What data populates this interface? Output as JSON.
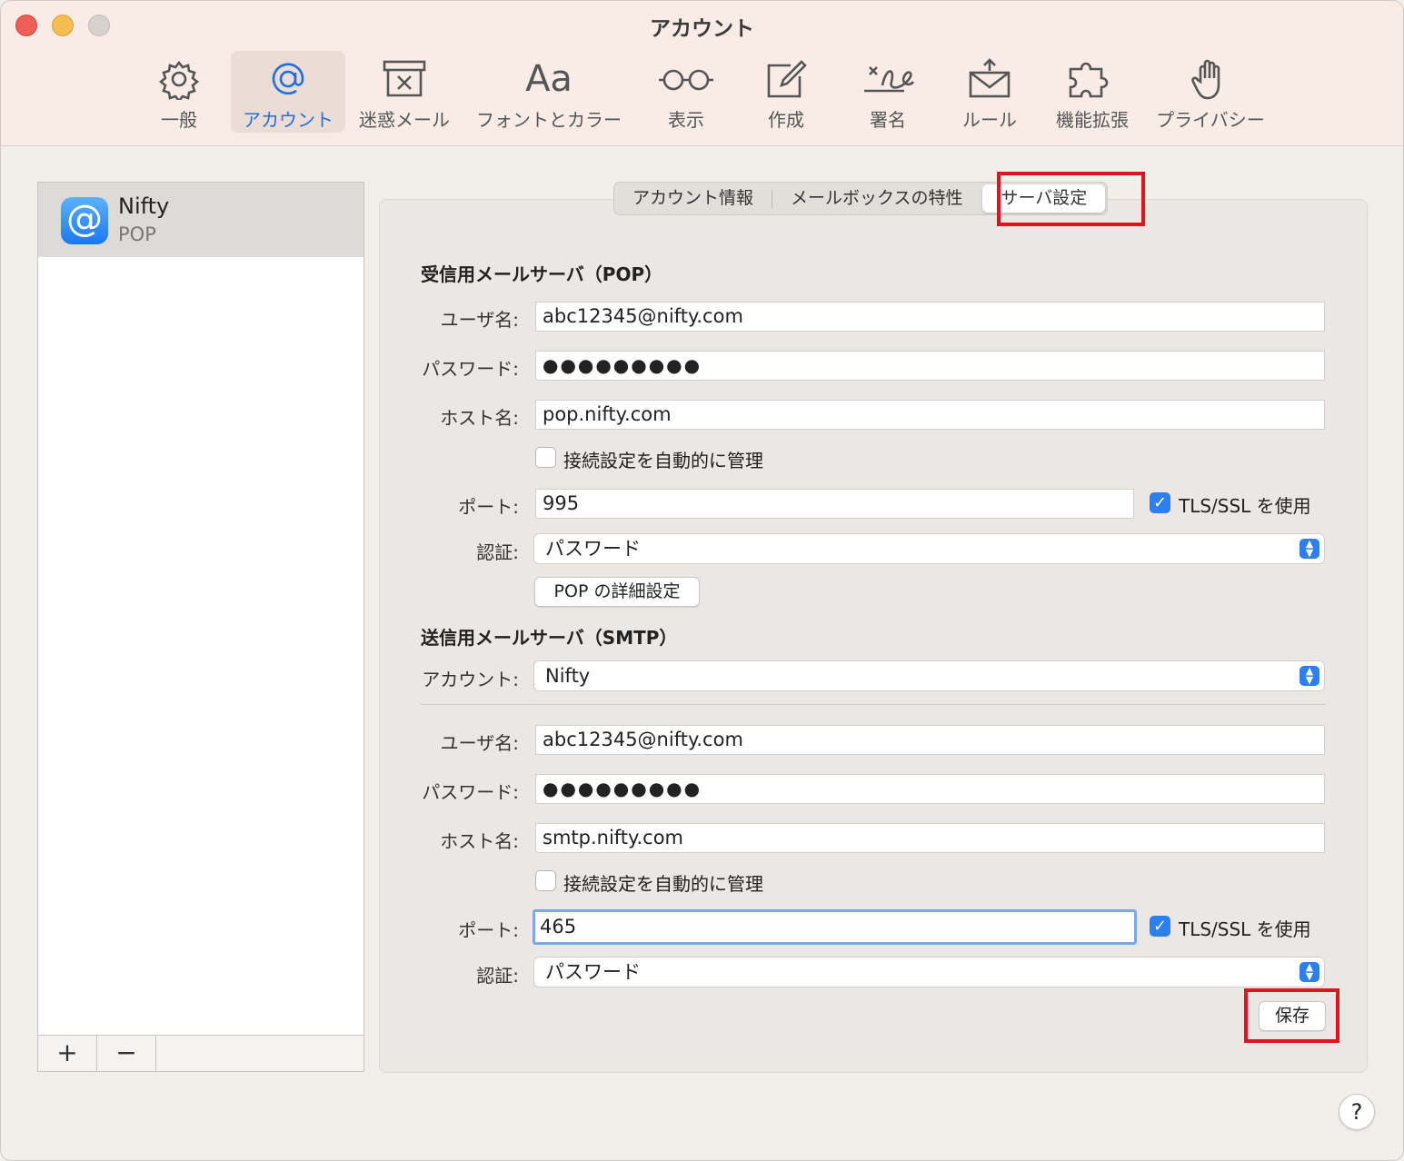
{
  "window": {
    "title": "アカウント"
  },
  "toolbar": {
    "items": [
      {
        "label": "一般",
        "icon": "gear-icon"
      },
      {
        "label": "アカウント",
        "icon": "at-icon"
      },
      {
        "label": "迷惑メール",
        "icon": "junk-icon"
      },
      {
        "label": "フォントとカラー",
        "icon": "font-icon",
        "glyph": "Aa"
      },
      {
        "label": "表示",
        "icon": "glasses-icon"
      },
      {
        "label": "作成",
        "icon": "compose-icon"
      },
      {
        "label": "署名",
        "icon": "signature-icon"
      },
      {
        "label": "ルール",
        "icon": "rules-icon"
      },
      {
        "label": "機能拡張",
        "icon": "extensions-icon"
      },
      {
        "label": "プライバシー",
        "icon": "privacy-icon"
      }
    ],
    "active": "アカウント"
  },
  "sidebar": {
    "account": {
      "name": "Nifty",
      "type": "POP",
      "icon_glyph": "@"
    },
    "add_label": "+",
    "remove_label": "−"
  },
  "tabs": [
    "アカウント情報",
    "メールボックスの特性",
    "サーバ設定"
  ],
  "selected_tab": "サーバ設定",
  "incoming": {
    "heading": "受信用メールサーバ（POP）",
    "username_label": "ユーザ名:",
    "username": "abc12345@nifty.com",
    "password_label": "パスワード:",
    "password": "●●●●●●●●●",
    "host_label": "ホスト名:",
    "host": "pop.nifty.com",
    "auto_manage_label": "接続設定を自動的に管理",
    "port_label": "ポート:",
    "port": "995",
    "tls_label": "TLS/SSL を使用",
    "auth_label": "認証:",
    "auth": "パスワード",
    "advanced_button": "POP の詳細設定"
  },
  "outgoing": {
    "heading": "送信用メールサーバ（SMTP）",
    "account_label": "アカウント:",
    "account": "Nifty",
    "username_label": "ユーザ名:",
    "username": "abc12345@nifty.com",
    "password_label": "パスワード:",
    "password": "●●●●●●●●●",
    "host_label": "ホスト名:",
    "host": "smtp.nifty.com",
    "auto_manage_label": "接続設定を自動的に管理",
    "port_label": "ポート:",
    "port": "465",
    "tls_label": "TLS/SSL を使用",
    "auth_label": "認証:",
    "auth": "パスワード"
  },
  "save_button": "保存",
  "help_label": "?",
  "colors": {
    "accent": "#2b7ff0",
    "highlight": "#e0141e"
  }
}
